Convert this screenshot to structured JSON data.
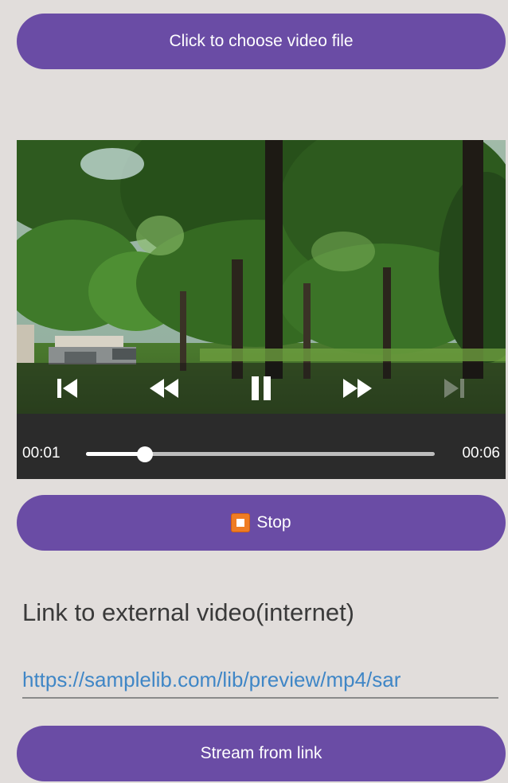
{
  "buttons": {
    "choose_label": "Click to choose video file",
    "stop_label": "Stop",
    "stream_label": "Stream from link"
  },
  "player": {
    "current_time": "00:01",
    "total_time": "00:06",
    "progress": 0.17,
    "state": "playing",
    "controls": [
      "previous-icon",
      "rewind-icon",
      "pause-icon",
      "fast-forward-icon",
      "next-icon"
    ],
    "next_enabled": false
  },
  "link": {
    "label": "Link to external video(internet)",
    "value": "https://samplelib.com/lib/preview/mp4/sar"
  },
  "colors": {
    "background": "#e1dddb",
    "button": "#6a4ca5",
    "stop_icon": "#ef7c23",
    "link_text": "#3f86c6"
  }
}
